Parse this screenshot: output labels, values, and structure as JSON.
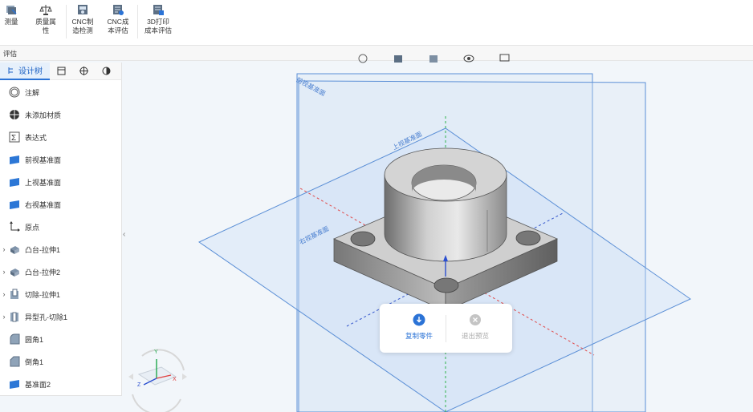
{
  "ribbon": {
    "buttons": [
      {
        "label": "测量",
        "icon": "measure-icon"
      },
      {
        "label": "质量属性",
        "icon": "mass-properties-icon"
      },
      {
        "label": "CNC制造检测",
        "icon": "cnc-manufacturing-check-icon"
      },
      {
        "label": "CNC成本评估",
        "icon": "cnc-cost-icon"
      },
      {
        "label": "3D打印成本评估",
        "icon": "3d-print-cost-icon"
      }
    ],
    "labels": {
      "measure": "测量",
      "mass_l1": "质量属",
      "mass_l2": "性",
      "cnc_l1": "CNC制",
      "cnc_l2": "造检测",
      "cost_l1": "CNC成",
      "cost_l2": "本评估",
      "print_l1": "3D打印",
      "print_l2": "成本评估"
    },
    "tab": "评估"
  },
  "panel": {
    "active_tab": "设计树",
    "tabs": [
      "design-tree-icon",
      "properties-icon",
      "target-icon",
      "appearance-icon"
    ],
    "tree": [
      {
        "label": "注解",
        "icon": "annotation-icon",
        "expandable": false
      },
      {
        "label": "未添加材质",
        "icon": "material-icon",
        "expandable": false
      },
      {
        "label": "表达式",
        "icon": "sigma-icon",
        "expandable": false
      },
      {
        "label": "前视基准面",
        "icon": "plane-icon",
        "expandable": false
      },
      {
        "label": "上视基准面",
        "icon": "plane-icon",
        "expandable": false
      },
      {
        "label": "右视基准面",
        "icon": "plane-icon",
        "expandable": false
      },
      {
        "label": "原点",
        "icon": "origin-icon",
        "expandable": false
      },
      {
        "label": "凸台-拉伸1",
        "icon": "extrude-boss-icon",
        "expandable": true
      },
      {
        "label": "凸台-拉伸2",
        "icon": "extrude-boss-icon",
        "expandable": true
      },
      {
        "label": "切除-拉伸1",
        "icon": "extrude-cut-icon",
        "expandable": true
      },
      {
        "label": "异型孔-切除1",
        "icon": "hole-wizard-icon",
        "expandable": true
      },
      {
        "label": "圆角1",
        "icon": "fillet-icon",
        "expandable": false
      },
      {
        "label": "倒角1",
        "icon": "chamfer-icon",
        "expandable": false
      },
      {
        "label": "基准面2",
        "icon": "plane-icon",
        "expandable": false
      }
    ]
  },
  "viewport": {
    "plane_labels": {
      "front": "前视基准面",
      "top": "上视基准面",
      "right": "右视基准面"
    },
    "triad": {
      "x": "X",
      "y": "Y",
      "z": "Z"
    }
  },
  "popup": {
    "copy_label": "复制零件",
    "exit_label": "退出预览"
  },
  "colors": {
    "accent": "#2b73d6",
    "plane_edge": "#5b8fd6",
    "plane_fill": "#c9ddf5"
  }
}
